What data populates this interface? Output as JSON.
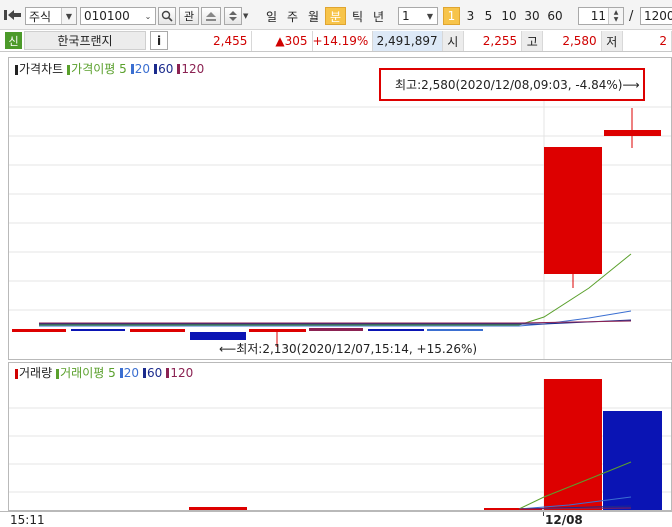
{
  "toolbar": {
    "market_select": "주식",
    "code_value": "010100",
    "interest_label": "관",
    "period_tabs": [
      {
        "label": "일",
        "active": false
      },
      {
        "label": "주",
        "active": false
      },
      {
        "label": "월",
        "active": false
      },
      {
        "label": "분",
        "active": true
      },
      {
        "label": "틱",
        "active": false
      },
      {
        "label": "년",
        "active": false
      }
    ],
    "interval_select": "1",
    "quick_intervals": [
      {
        "label": "1",
        "active": true
      },
      {
        "label": "3",
        "active": false
      },
      {
        "label": "5",
        "active": false
      },
      {
        "label": "10",
        "active": false
      },
      {
        "label": "30",
        "active": false
      },
      {
        "label": "60",
        "active": false
      }
    ],
    "count_value": "11",
    "count_sep": "/",
    "total_value": "1200"
  },
  "quote": {
    "badge": "신",
    "name": "한국프랜지",
    "info_label": "i",
    "price": "2,455",
    "change": "▲305",
    "change_pct": "+14.19%",
    "volume": "2,491,897",
    "open_label": "시",
    "open": "2,255",
    "high_label": "고",
    "high": "2,580",
    "low_label": "저",
    "low": "2"
  },
  "price_panel": {
    "legend": [
      {
        "text": "가격차트",
        "color": "#222222",
        "marker": "#222222"
      },
      {
        "text": "가격이평 5",
        "color": "#5aa02c",
        "marker": "#5aa02c"
      },
      {
        "text": "20",
        "color": "#3b6fd1",
        "marker": "#3b6fd1"
      },
      {
        "text": "60",
        "color": "#1a2a8c",
        "marker": "#1a2a8c"
      },
      {
        "text": "120",
        "color": "#8b2252",
        "marker": "#8b2252"
      }
    ],
    "high_annotation": "최고:2,580(2020/12/08,09:03, -4.84%)⟶",
    "low_annotation": "⟵최저:2,130(2020/12/07,15:14, +15.26%)"
  },
  "volume_panel": {
    "legend": [
      {
        "text": "거래량",
        "color": "#222222",
        "marker": "#d00000"
      },
      {
        "text": "거래이평 5",
        "color": "#5aa02c",
        "marker": "#5aa02c"
      },
      {
        "text": "20",
        "color": "#3b6fd1",
        "marker": "#3b6fd1"
      },
      {
        "text": "60",
        "color": "#1a2a8c",
        "marker": "#1a2a8c"
      },
      {
        "text": "120",
        "color": "#8b2252",
        "marker": "#8b2252"
      }
    ]
  },
  "xaxis": {
    "labels": [
      {
        "text": "15:11",
        "bold": false
      },
      {
        "text": "12/08",
        "bold": true
      }
    ]
  },
  "colors": {
    "up": "#dd0000",
    "down": "#0a14b4",
    "ma5": "#5aa02c",
    "ma20": "#3b6fd1",
    "ma60": "#1a2a8c",
    "ma120": "#8b2252",
    "highlight": "#dd0000"
  }
}
